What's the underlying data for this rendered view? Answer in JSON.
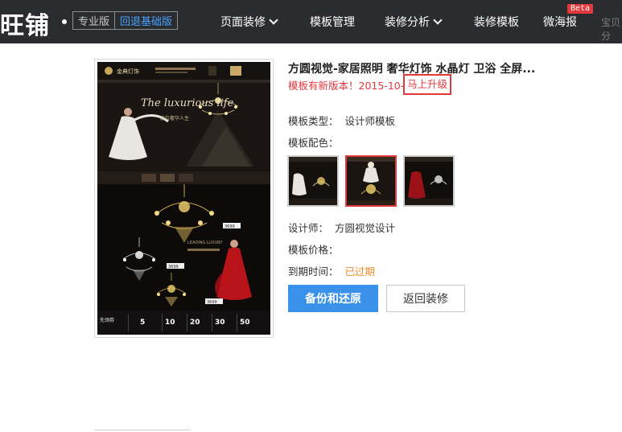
{
  "header": {
    "logo": "旺铺",
    "edition_pro": "专业版",
    "edition_basic": "回退基础版",
    "nav": [
      {
        "label": "页面装修"
      },
      {
        "label": "模板管理"
      },
      {
        "label": "装修分析"
      },
      {
        "label": "装修模板"
      },
      {
        "label": "微海报"
      },
      {
        "label": "宝贝分"
      }
    ],
    "beta_badge": "Beta"
  },
  "template": {
    "title": "方圆视觉-家居照明 奢华灯饰 水晶灯 卫浴 全屏...",
    "notice": "模板有新版本！2015-10-1",
    "upgrade_link": "马上升级",
    "type_label": "模板类型：",
    "type_value": "设计师模板",
    "color_label": "模板配色：",
    "designer_label": "设计师：",
    "designer_value": "方圆视觉设计",
    "price_label": "模板价格：",
    "price_value": "",
    "expiry_label": "到期时间：",
    "expiry_value": "已过期",
    "preview_texts": {
      "brand": "金典灯饰",
      "script": "The luxurious life",
      "tagline": "品位奢华人生",
      "leading": "LEADING LUXURY",
      "tags": [
        "3699",
        "3699",
        "3699"
      ],
      "coupon_label": "先领券",
      "coupons": [
        "5",
        "10",
        "20",
        "30",
        "50"
      ]
    }
  },
  "actions": {
    "backup_restore": "备份和还原",
    "back_to_decor": "返回装修"
  },
  "colors": {
    "accent_blue": "#3a91ea",
    "alert_red": "#e4393c",
    "expired_orange": "#f08c2b",
    "topbar": "#2b2c30"
  }
}
